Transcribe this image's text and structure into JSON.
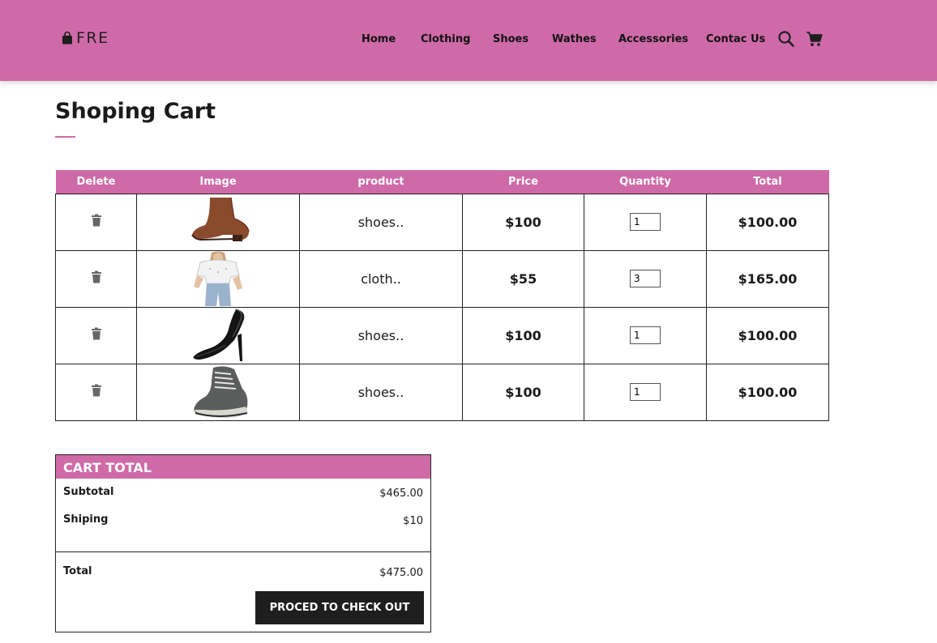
{
  "brand": {
    "name": "FRE",
    "icon": "shopping-bag-icon"
  },
  "nav": {
    "items": [
      {
        "label": "Home"
      },
      {
        "label": "Clothing"
      },
      {
        "label": "Shoes"
      },
      {
        "label": "Wathes"
      },
      {
        "label": "Accessories"
      },
      {
        "label": "Contac Us"
      }
    ],
    "search_icon": "search-icon",
    "cart_icon": "cart-icon"
  },
  "page": {
    "title": "Shoping Cart"
  },
  "table": {
    "headers": [
      "Delete",
      "Image",
      "product",
      "Price",
      "Quantity",
      "Total"
    ],
    "rows": [
      {
        "image": "brown-ankle-boot",
        "product": "shoes..",
        "price": "$100",
        "quantity": "1",
        "total": "$100.00"
      },
      {
        "image": "white-blouse-jeans-outfit",
        "product": "cloth..",
        "price": "$55",
        "quantity": "3",
        "total": "$165.00"
      },
      {
        "image": "black-high-heel",
        "product": "shoes..",
        "price": "$100",
        "quantity": "1",
        "total": "$100.00"
      },
      {
        "image": "grey-hiking-boot",
        "product": "shoes..",
        "price": "$100",
        "quantity": "1",
        "total": "$100.00"
      }
    ]
  },
  "cart_total": {
    "heading": "CART TOTAL",
    "subtotal_label": "Subtotal",
    "subtotal_value": "$465.00",
    "shipping_label": "Shiping",
    "shipping_value": "$10",
    "total_label": "Total",
    "total_value": "$475.00",
    "checkout_label": "PROCED TO CHECK OUT"
  },
  "colors": {
    "accent": "#cf6aa8",
    "button": "#1e1e1e",
    "text": "#1a1a1a"
  }
}
